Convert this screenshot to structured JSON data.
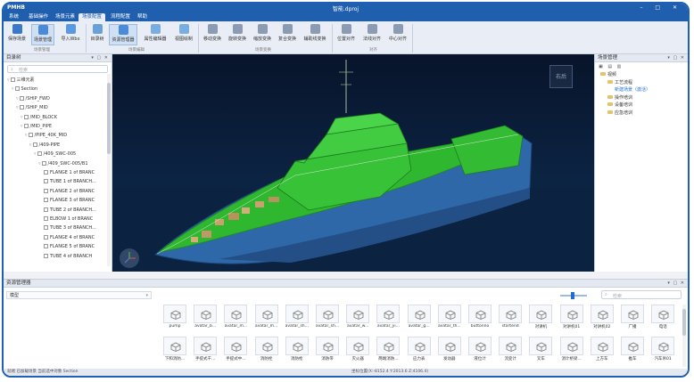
{
  "app": {
    "logo": "PMHB",
    "title": "智能.dproj",
    "window_controls": "– □ ✕"
  },
  "menu": {
    "tabs": [
      {
        "label": "系统"
      },
      {
        "label": "基础操作"
      },
      {
        "label": "场景元素"
      },
      {
        "label": "场景配置",
        "active": true
      },
      {
        "label": "流程配置"
      },
      {
        "label": "帮助"
      }
    ]
  },
  "ribbon": {
    "buttons": [
      {
        "label": "保存场景",
        "icon": "save-icon"
      },
      {
        "label": "场景管理",
        "icon": "scene-manage-icon",
        "active": true
      },
      {
        "label": "导入Wbx",
        "icon": "import-icon"
      },
      {
        "label": "目录树",
        "icon": "tree-icon"
      },
      {
        "label": "资源管理器",
        "icon": "resource-manager-icon",
        "active": true
      },
      {
        "label": "属性编辑器",
        "icon": "property-editor-icon"
      },
      {
        "label": "视图绘制",
        "icon": "view-draw-icon"
      },
      {
        "label": "移动变换",
        "icon": "move-icon"
      },
      {
        "label": "旋转变换",
        "icon": "rotate-icon"
      },
      {
        "label": "缩放变换",
        "icon": "scale-icon"
      },
      {
        "label": "复合变换",
        "icon": "compound-icon"
      },
      {
        "label": "辅助线变换",
        "icon": "guideline-icon"
      },
      {
        "label": "位置对齐",
        "icon": "align-position-icon"
      },
      {
        "label": "法线对齐",
        "icon": "align-normal-icon"
      },
      {
        "label": "中心对齐",
        "icon": "align-center-icon"
      }
    ],
    "groups": [
      "场景管理",
      "场景编辑",
      "场景变换",
      "对齐"
    ]
  },
  "left_panel": {
    "title": "目录树",
    "controls": "▾ ▢ ✕",
    "search_placeholder": "检索",
    "tree": [
      {
        "label": "三维元素",
        "level": 0
      },
      {
        "label": "Section",
        "level": 1
      },
      {
        "label": "/SHIP_FWD",
        "level": 2
      },
      {
        "label": "/SHIP_MID",
        "level": 2
      },
      {
        "label": "/MID_BLOCK",
        "level": 3
      },
      {
        "label": "/MID_PIPE",
        "level": 3
      },
      {
        "label": "/PIPE_40K_MID",
        "level": 4
      },
      {
        "label": "/409-PIPE",
        "level": 5
      },
      {
        "label": "/409_SWC-005",
        "level": 6
      },
      {
        "label": "/409_SWC-005/B1",
        "level": 7
      },
      {
        "label": "FLANGE 1 of BRANC",
        "level": 8
      },
      {
        "label": "TUBE 1 of BRANCH...",
        "level": 8
      },
      {
        "label": "FLANGE 2 of BRANC",
        "level": 8
      },
      {
        "label": "FLANGE 3 of BRANC",
        "level": 8
      },
      {
        "label": "TUBE 2 of BRANCH...",
        "level": 8
      },
      {
        "label": "ELBOW 1 of BRANC",
        "level": 8
      },
      {
        "label": "TUBE 3 of BRANCH...",
        "level": 8
      },
      {
        "label": "FLANGE 4 of BRANC",
        "level": 8
      },
      {
        "label": "FLANGE 5 of BRANC",
        "level": 8
      },
      {
        "label": "TUBE 4 of BRANCH",
        "level": 8
      }
    ]
  },
  "viewport": {
    "view_cube_label": "右后"
  },
  "right_panel": {
    "title": "场景管理",
    "controls": "▾ ▢ ✕",
    "tree": [
      {
        "label": "视频",
        "level": 0,
        "link": false
      },
      {
        "label": "工艺流程",
        "level": 1,
        "link": false
      },
      {
        "label": "新建场景（激活）",
        "level": 2,
        "link": true
      },
      {
        "label": "操作培训",
        "level": 1,
        "link": false
      },
      {
        "label": "设备培训",
        "level": 1,
        "link": false
      },
      {
        "label": "应急培训",
        "level": 1,
        "link": false
      }
    ]
  },
  "resources": {
    "title": "资源管理器",
    "controls": "▾ ▢ ✕",
    "type_value": "模型",
    "search_placeholder": "检索",
    "items_row1": [
      "pump",
      "avatar_b...",
      "avatar_m...",
      "avatar_m...",
      "avatar_sh...",
      "avatar_sh...",
      "avatar_w...",
      "avatar_yi...",
      "avatar_g...",
      "avatar_th...",
      "buttonno",
      "startend",
      "对讲机",
      "对讲机01",
      "对讲机02",
      "广播",
      "电话"
    ],
    "items_row2": [
      "下和消防...",
      "手提式干...",
      "手提式中...",
      "消防栓",
      "消防枪",
      "消防带",
      "灭火器",
      "两端消防...",
      "应力表",
      "发动器",
      "液位计",
      "流变计",
      "叉车",
      "消计桥梁...",
      "上方车",
      "推车",
      "汽车吊01"
    ]
  },
  "status": {
    "left": "就绪    已加载场景    当前选中对象    Section",
    "right": "坐标位置(X:-8152.4  Y:2013.6  Z:4106.4)"
  }
}
